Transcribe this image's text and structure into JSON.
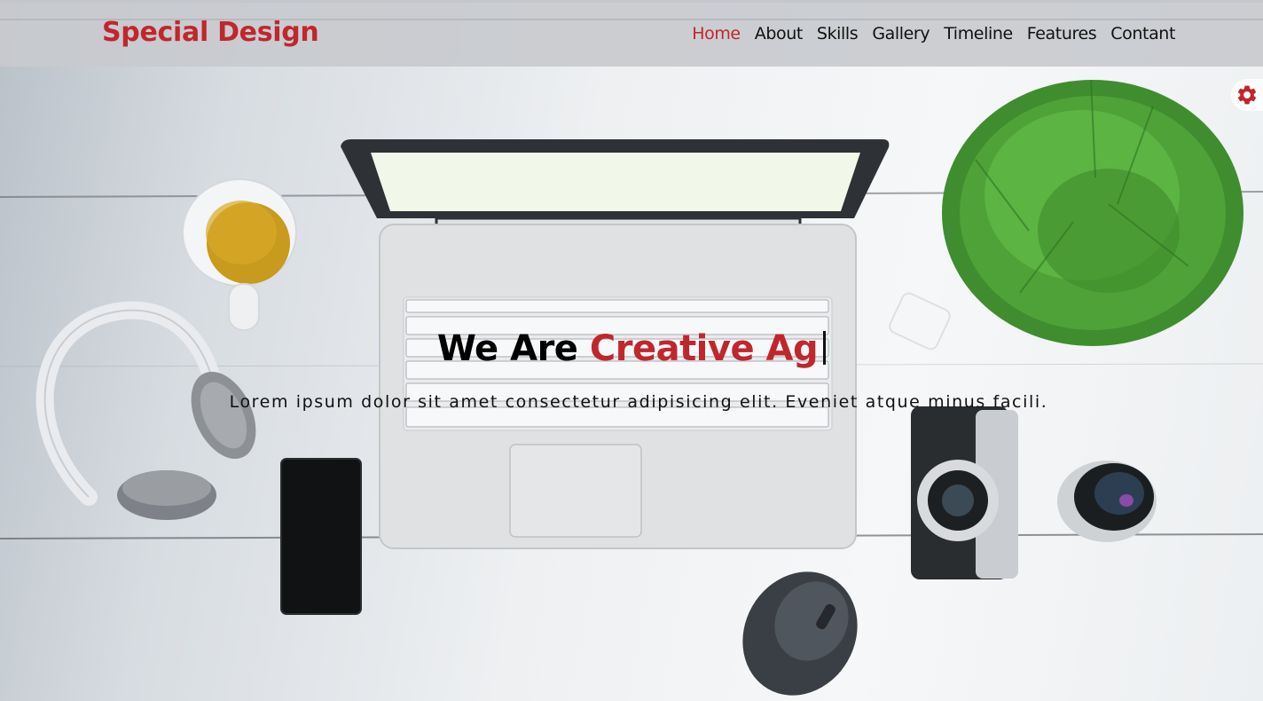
{
  "header": {
    "logo": "Special Design",
    "nav": [
      {
        "label": "Home",
        "active": true
      },
      {
        "label": "About",
        "active": false
      },
      {
        "label": "Skills",
        "active": false
      },
      {
        "label": "Gallery",
        "active": false
      },
      {
        "label": "Timeline",
        "active": false
      },
      {
        "label": "Features",
        "active": false
      },
      {
        "label": "Contant",
        "active": false
      }
    ]
  },
  "settings": {
    "icon": "gear-icon"
  },
  "hero": {
    "title_prefix": "We Are",
    "title_accent": "Creative Ag",
    "subtitle": "Lorem ipsum dolor sit amet consectetur adipisicing elit. Eveniet atque minus facili."
  },
  "colors": {
    "accent": "#c0272d",
    "header_bg": "#c8cace",
    "text": "#111111"
  }
}
